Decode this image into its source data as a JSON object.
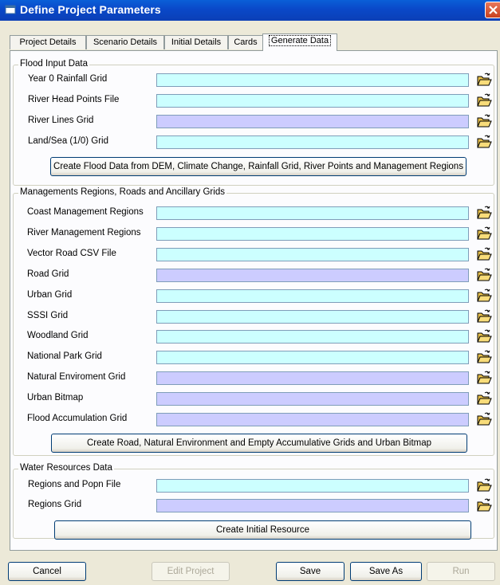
{
  "window": {
    "title": "Define Project Parameters"
  },
  "tabs": [
    "Project Details",
    "Scenario Details",
    "Initial Details",
    "Cards",
    "Generate Data"
  ],
  "flood": {
    "legend": "Flood Input Data",
    "fields": [
      {
        "label": "Year 0 Rainfall Grid",
        "value": "",
        "color": "#ccffff"
      },
      {
        "label": "River Head Points File",
        "value": "",
        "color": "#ccffff"
      },
      {
        "label": "River Lines Grid",
        "value": "",
        "color": "#ccccff"
      },
      {
        "label": "Land/Sea (1/0) Grid",
        "value": "",
        "color": "#ccffff"
      }
    ],
    "button": "Create Flood Data from DEM, Climate Change, Rainfall Grid, River Points and Management Regions"
  },
  "management": {
    "legend": "Managements Regions, Roads and Ancillary Grids",
    "fields": [
      {
        "label": "Coast Management Regions",
        "value": "",
        "color": "#ccffff"
      },
      {
        "label": "River Management Regions",
        "value": "",
        "color": "#ccffff"
      },
      {
        "label": "Vector Road CSV File",
        "value": "",
        "color": "#ccffff"
      },
      {
        "label": "Road Grid",
        "value": "",
        "color": "#ccccff"
      },
      {
        "label": "Urban Grid",
        "value": "",
        "color": "#ccffff"
      },
      {
        "label": "SSSI Grid",
        "value": "",
        "color": "#ccffff"
      },
      {
        "label": "Woodland Grid",
        "value": "",
        "color": "#ccffff"
      },
      {
        "label": "National Park Grid",
        "value": "",
        "color": "#ccffff"
      },
      {
        "label": "Natural Enviroment Grid",
        "value": "",
        "color": "#ccccff"
      },
      {
        "label": "Urban Bitmap",
        "value": "",
        "color": "#ccccff"
      },
      {
        "label": "Flood Accumulation Grid",
        "value": "",
        "color": "#ccccff"
      }
    ],
    "button": "Create Road, Natural Environment and Empty Accumulative Grids and Urban Bitmap"
  },
  "water": {
    "legend": "Water Resources Data",
    "fields": [
      {
        "label": "Regions and Popn File",
        "value": "",
        "color": "#ccffff"
      },
      {
        "label": "Regions Grid",
        "value": "",
        "color": "#ccccff"
      }
    ],
    "button": "Create Initial Resource"
  },
  "footer": {
    "cancel": "Cancel",
    "edit_project": "Edit Project",
    "save": "Save",
    "save_as": "Save As",
    "run": "Run"
  },
  "icons": {
    "browse": "open-folder-icon",
    "app": "window-app-icon",
    "close": "close-icon"
  }
}
